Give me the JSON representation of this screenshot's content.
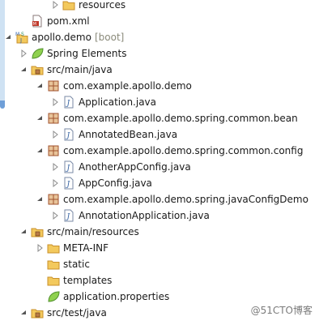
{
  "tree": {
    "resources_folder": "resources",
    "pom_file": "pom.xml",
    "project_name": "apollo.demo",
    "project_tag": "[boot]",
    "spring_elements": "Spring Elements",
    "src_main_java": "src/main/java",
    "pkg_apollo_demo": "com.example.apollo.demo",
    "application_java": "Application.java",
    "pkg_common_bean": "com.example.apollo.demo.spring.common.bean",
    "annotated_bean_java": "AnnotatedBean.java",
    "pkg_common_config": "com.example.apollo.demo.spring.common.config",
    "another_app_config_java": "AnotherAppConfig.java",
    "app_config_java": "AppConfig.java",
    "pkg_java_config_demo": "com.example.apollo.demo.spring.javaConfigDemo",
    "annotation_application_java": "AnnotationApplication.java",
    "src_main_resources": "src/main/resources",
    "meta_inf": "META-INF",
    "static_folder": "static",
    "templates_folder": "templates",
    "application_properties": "application.properties",
    "src_test_java": "src/test/java"
  },
  "watermark": "@51CTO博客",
  "colors": {
    "package": "#a0522d",
    "folder": "#e0a83a",
    "source_folder": "#d9a441",
    "java_file": "#3d6db5",
    "spring_leaf": "#6db33f"
  }
}
